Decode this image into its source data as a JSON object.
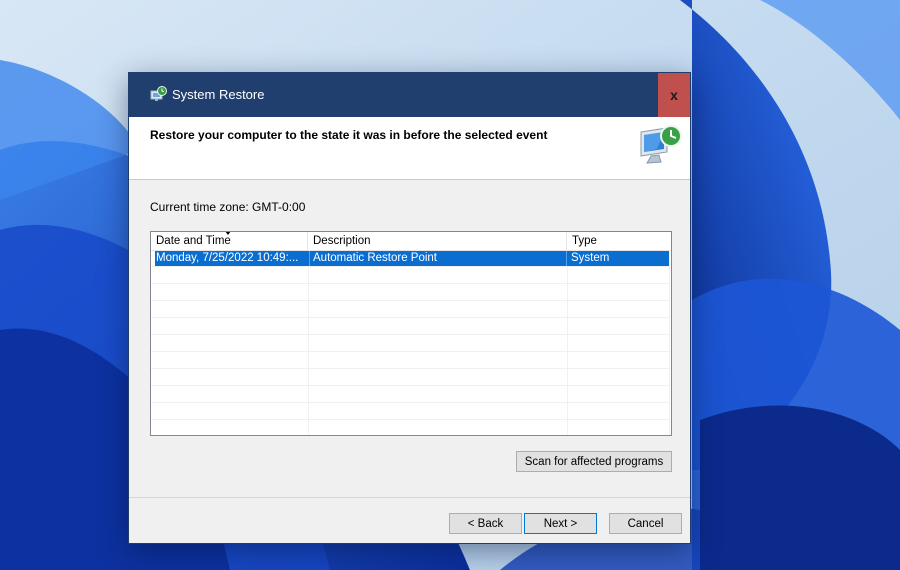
{
  "window": {
    "title": "System Restore",
    "close_glyph": "x"
  },
  "header": {
    "heading": "Restore your computer to the state it was in before the selected event",
    "icon": "system-restore-icon"
  },
  "timezone": {
    "label": "Current time zone: GMT-0:00"
  },
  "table": {
    "columns": [
      "Date and Time",
      "Description",
      "Type"
    ],
    "sort_column": "Date and Time",
    "rows": [
      {
        "date": "Monday, 7/25/2022 10:49:...",
        "description": "Automatic Restore Point",
        "type": "System",
        "selected": true
      }
    ]
  },
  "buttons": {
    "scan": "Scan for affected programs",
    "back": "< Back",
    "next": "Next >",
    "cancel": "Cancel"
  },
  "colors": {
    "titlebar": "#213f6e",
    "close": "#c0504d",
    "selection": "#0a6ed1"
  }
}
